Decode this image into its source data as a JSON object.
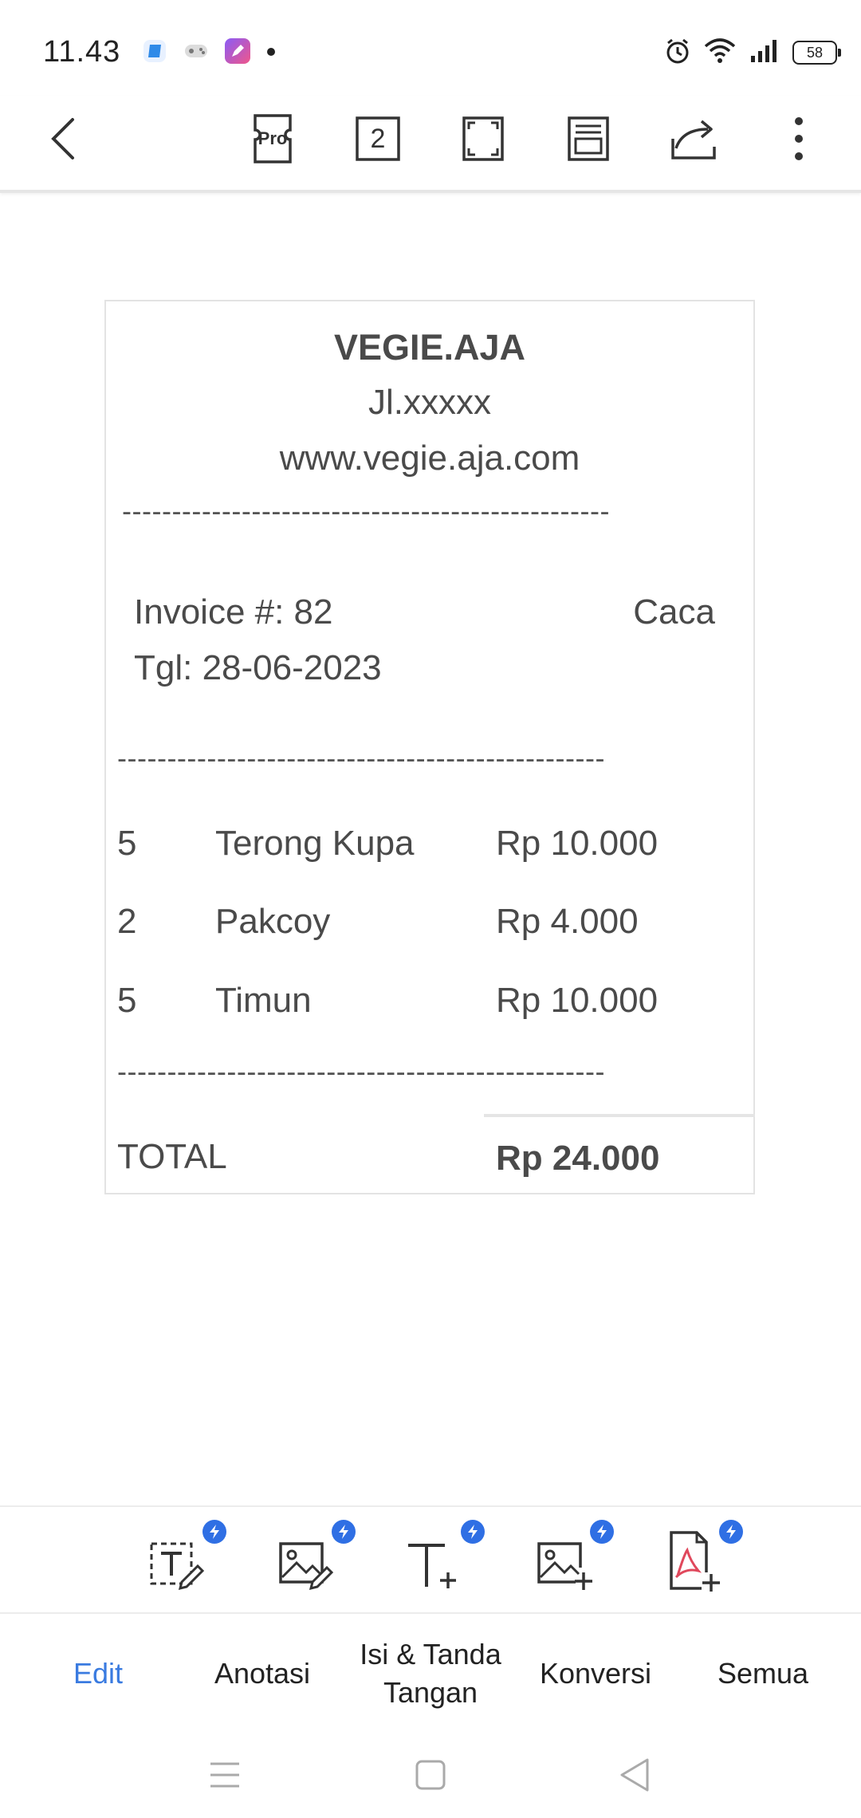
{
  "status": {
    "time": "11.43",
    "battery": "58",
    "app_icons": [
      "blue-app-icon",
      "game-controller-icon",
      "pen-app-icon",
      "notification-dot-icon"
    ],
    "right_icons": [
      "alarm-icon",
      "wifi-icon",
      "signal-icon",
      "battery-icon"
    ]
  },
  "toolbar": {
    "back": "back-arrow-icon",
    "pro_label": "Pro",
    "page_count": "2",
    "items": [
      "pro-ticket-icon",
      "page-number-icon",
      "fullscreen-icon",
      "reading-mode-icon",
      "share-icon",
      "more-icon"
    ]
  },
  "receipt": {
    "store_name": "VEGIE.AJA",
    "address": "Jl.xxxxx",
    "website": "www.vegie.aja.com",
    "separator": "-------------------------------------------------",
    "invoice": "Invoice #: 82",
    "cashier": "Caca",
    "date": "Tgl: 28-06-2023",
    "items": [
      {
        "qty": "5",
        "name": "Terong Kupa",
        "price": "Rp 10.000"
      },
      {
        "qty": "2",
        "name": "Pakcoy",
        "price": "Rp 4.000"
      },
      {
        "qty": "5",
        "name": "Timun",
        "price": "Rp 10.000"
      }
    ],
    "total_label": "TOTAL",
    "total_value": "Rp 24.000"
  },
  "tools": [
    "edit-text-icon",
    "edit-image-icon",
    "add-text-icon",
    "add-image-icon",
    "pdf-convert-icon"
  ],
  "tools_badge": "lightning-icon",
  "tabs": [
    {
      "label": "Edit",
      "active": true
    },
    {
      "label": "Anotasi",
      "active": false
    },
    {
      "label": "Isi & Tanda Tangan",
      "active": false
    },
    {
      "label": "Konversi",
      "active": false
    },
    {
      "label": "Semua",
      "active": false
    }
  ],
  "colors": {
    "accent": "#3a7be0",
    "badge": "#2f6fe4"
  }
}
